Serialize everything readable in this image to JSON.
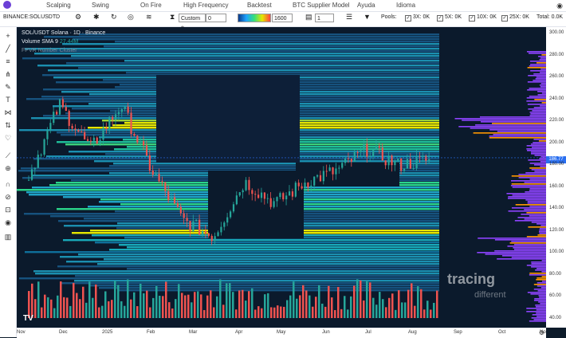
{
  "menu": [
    "Scalping",
    "Swing",
    "On Fire",
    "High Frequency",
    "Backtest",
    "BTC Supplier Model",
    "Ayuda",
    "Idioma"
  ],
  "toolbar": {
    "symbol": "BINANCE:SOLUSDT",
    "interval": "D",
    "custom_label": "Custom ÷",
    "custom_value": "0",
    "level_value": "1600",
    "count_value": "1",
    "pools_label": "Pools:",
    "pools": [
      {
        "label": "3X: 0K",
        "checked": true
      },
      {
        "label": "5X: 0K",
        "checked": true
      },
      {
        "label": "10X: 0K",
        "checked": true
      },
      {
        "label": "25X: 0K",
        "checked": true
      }
    ],
    "total": "Total: 0.0K"
  },
  "legend": {
    "title": "SOL/USDT Solana · 1D · Binance",
    "volume": "Volume SMA 9",
    "volume_value": "27.44M",
    "sub": "FPVR Number Cluster"
  },
  "price_tag": "186.77",
  "watermark": {
    "line1": "tracing",
    "line2": "different"
  },
  "y_ticks": [
    "300.00",
    "280.00",
    "260.00",
    "240.00",
    "220.00",
    "200.00",
    "180.00",
    "160.00",
    "140.00",
    "120.00",
    "100.00",
    "80.00",
    "60.00",
    "40.00"
  ],
  "x_ticks": [
    "Nov",
    "Dec",
    "2025",
    "Feb",
    "Mar",
    "Apr",
    "May",
    "Jun",
    "Jul",
    "Aug",
    "Sep",
    "Oct",
    "No"
  ],
  "colors": {
    "accent": "#2a6ff0",
    "up": "#26a69a",
    "down": "#ef5350",
    "profile": "#9c27b0",
    "heat_hi": "#e6e600"
  },
  "chart_data": {
    "type": "line",
    "title": "SOL/USDT Solana · 1D · Binance",
    "xlabel": "",
    "ylabel": "",
    "ylim": [
      40,
      300
    ],
    "x": [
      "Nov",
      "Dec",
      "2025",
      "Feb",
      "Mar",
      "Apr",
      "May",
      "Jun",
      "Jul",
      "Aug"
    ],
    "series": [
      {
        "name": "SOL/USDT",
        "values": [
          170,
          235,
          195,
          235,
          175,
          130,
          115,
          165,
          145,
          165,
          175,
          195,
          180,
          185
        ]
      }
    ]
  }
}
